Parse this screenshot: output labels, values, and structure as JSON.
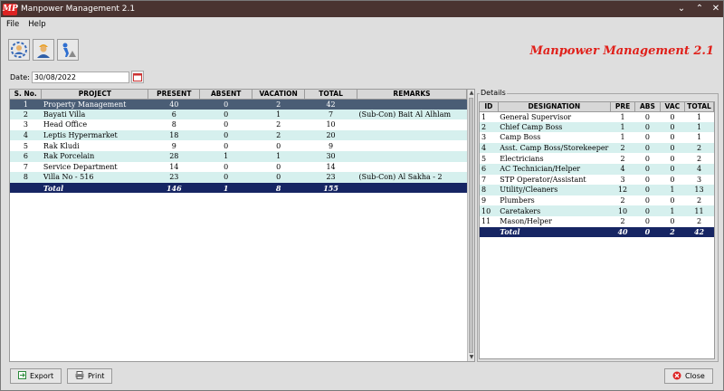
{
  "window": {
    "logo": "MP",
    "title": "Manpower Management 2.1",
    "controls": {
      "minimize": "⌄",
      "maximize": "⌃",
      "close": "✕"
    }
  },
  "menu": [
    "File",
    "Help"
  ],
  "toolbar": {
    "icons": [
      "users-gear-icon",
      "worker-icon",
      "construction-icon"
    ]
  },
  "brand": "Manpower Management 2.1",
  "date": {
    "label": "Date:",
    "value": "30/08/2022"
  },
  "main_table": {
    "headers": [
      "S. No.",
      "PROJECT",
      "PRESENT",
      "ABSENT",
      "VACATION",
      "TOTAL",
      "REMARKS"
    ],
    "rows": [
      [
        "1",
        "Property Management",
        "40",
        "0",
        "2",
        "42",
        ""
      ],
      [
        "2",
        "Bayati Villa",
        "6",
        "0",
        "1",
        "7",
        "(Sub-Con) Bait Al Alhlam"
      ],
      [
        "3",
        "Head Office",
        "8",
        "0",
        "2",
        "10",
        ""
      ],
      [
        "4",
        "Leptis Hypermarket",
        "18",
        "0",
        "2",
        "20",
        ""
      ],
      [
        "5",
        "Rak Kludi",
        "9",
        "0",
        "0",
        "9",
        ""
      ],
      [
        "6",
        "Rak Porcelain",
        "28",
        "1",
        "1",
        "30",
        ""
      ],
      [
        "7",
        "Service Department",
        "14",
        "0",
        "0",
        "14",
        ""
      ],
      [
        "8",
        "Villa No - 516",
        "23",
        "0",
        "0",
        "23",
        "(Sub-Con) Al Sakha - 2"
      ]
    ],
    "total": [
      "",
      "Total",
      "146",
      "1",
      "8",
      "155",
      ""
    ]
  },
  "details": {
    "title": "Details",
    "headers": [
      "ID",
      "DESIGNATION",
      "PRE",
      "ABS",
      "VAC",
      "TOTAL"
    ],
    "rows": [
      [
        "1",
        "General Supervisor",
        "1",
        "0",
        "0",
        "1"
      ],
      [
        "2",
        "Chief Camp Boss",
        "1",
        "0",
        "0",
        "1"
      ],
      [
        "3",
        "Camp Boss",
        "1",
        "0",
        "0",
        "1"
      ],
      [
        "4",
        "Asst. Camp Boss/Storekeeper",
        "2",
        "0",
        "0",
        "2"
      ],
      [
        "5",
        "Electricians",
        "2",
        "0",
        "0",
        "2"
      ],
      [
        "6",
        "AC Technician/Helper",
        "4",
        "0",
        "0",
        "4"
      ],
      [
        "7",
        "STP Operator/Assistant",
        "3",
        "0",
        "0",
        "3"
      ],
      [
        "8",
        "Utility/Cleaners",
        "12",
        "0",
        "1",
        "13"
      ],
      [
        "9",
        "Plumbers",
        "2",
        "0",
        "0",
        "2"
      ],
      [
        "10",
        "Caretakers",
        "10",
        "0",
        "1",
        "11"
      ],
      [
        "11",
        "Mason/Helper",
        "2",
        "0",
        "0",
        "2"
      ]
    ],
    "total": [
      "",
      "Total",
      "40",
      "0",
      "2",
      "42"
    ]
  },
  "buttons": {
    "export": "Export",
    "print": "Print",
    "close": "Close"
  },
  "colors": {
    "selected_row": "#4a5d75",
    "alt_row": "#d6f0ee",
    "total_row": "#162563",
    "brand": "#e0201a",
    "titlebar": "#4a3431"
  }
}
